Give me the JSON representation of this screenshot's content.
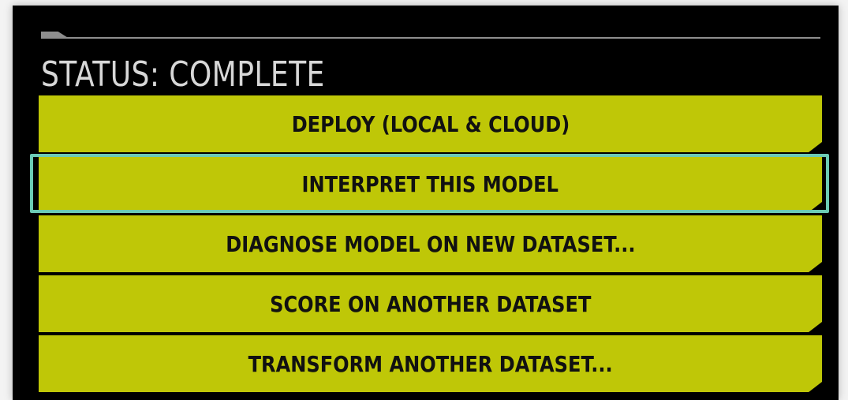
{
  "status": {
    "title": "STATUS: COMPLETE"
  },
  "actions": [
    {
      "label": "DEPLOY (LOCAL & CLOUD)"
    },
    {
      "label": "INTERPRET THIS MODEL",
      "highlighted": true
    },
    {
      "label": "DIAGNOSE MODEL ON NEW DATASET..."
    },
    {
      "label": "SCORE ON ANOTHER DATASET"
    },
    {
      "label": "TRANSFORM ANOTHER DATASET..."
    }
  ],
  "colors": {
    "panel_background": "#000000",
    "button_fill": "#bfc707",
    "button_text": "#111111",
    "status_text": "#d7d7d7",
    "highlight": "#6ccbb5"
  }
}
